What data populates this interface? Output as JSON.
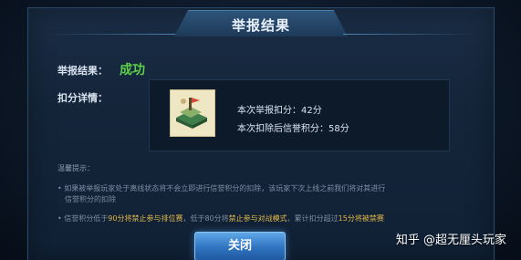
{
  "dialog": {
    "title": "举报结果",
    "result_label": "举报结果：",
    "result_value": "成功",
    "detail_label": "扣分详情：",
    "detail": {
      "line1": "本次举报扣分：42分",
      "line2": "本次扣除后信誉积分：58分"
    },
    "tips": {
      "title": "温馨提示：",
      "tip1_a": "• 如果被举报玩家处于离线状态将不会立即进行信誉积分的扣除，该玩家下次上线之前我们将对其进行",
      "tip1_b": "信誉积分的扣除",
      "tip2_pre": "• 信誉积分低于",
      "tip2_h1": "90分将禁止参与排位赛",
      "tip2_mid": "，低于",
      "tip2_mid2": "80分将",
      "tip2_h2": "禁止参与对战模式",
      "tip2_mid3": "，累计扣分超过",
      "tip2_h3": "15分将被禁赛"
    },
    "close_label": "关闭"
  },
  "watermark": "知乎 @超无厘头玩家",
  "colors": {
    "success": "#5fd04a",
    "highlight": "#e2b84a",
    "button": "#2f73c0"
  }
}
